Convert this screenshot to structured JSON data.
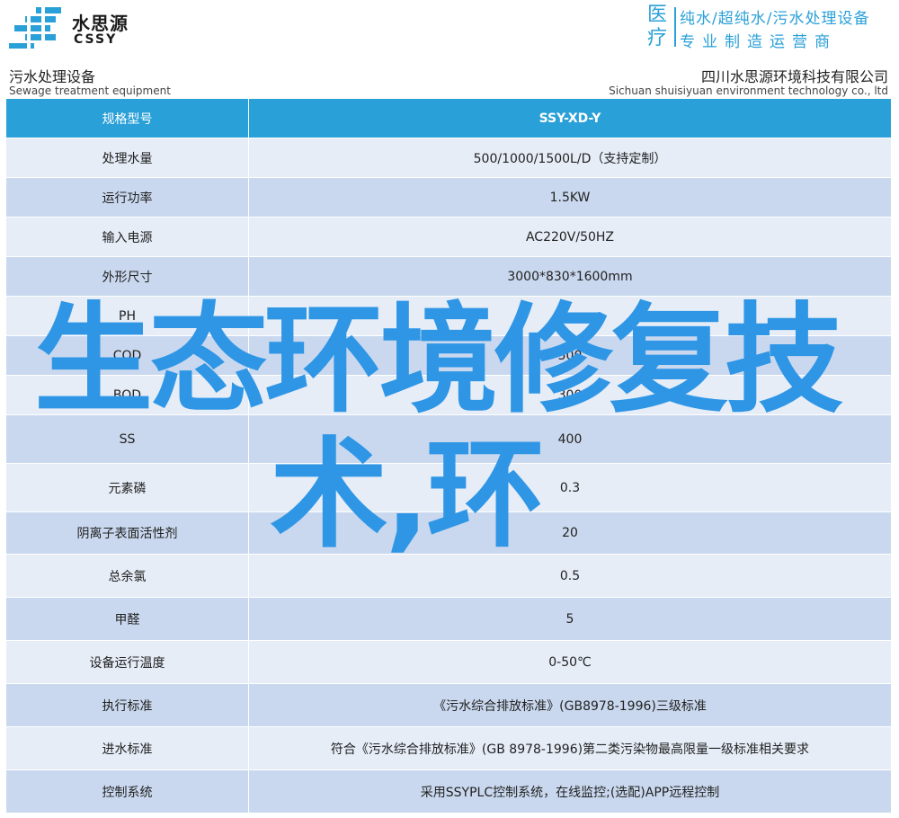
{
  "brand": {
    "name_cn": "水思源",
    "name_en": "CSSY",
    "accent_color": "#2aa0d8"
  },
  "header_right": {
    "category": "医疗",
    "line1": "纯水/超纯水/污水处理设备",
    "line2": "专业制造运营商"
  },
  "subheader": {
    "left_cn": "污水处理设备",
    "left_en": "Sewage treatment equipment",
    "right_cn": "四川水思源环境科技有限公司",
    "right_en": "Sichuan shuisiyuan environment technology co., ltd"
  },
  "table": {
    "header": {
      "label": "规格型号",
      "value": "SSY-XD-Y"
    },
    "rows": [
      {
        "label": "处理水量",
        "value": "500/1000/1500L/D（支持定制）"
      },
      {
        "label": "运行功率",
        "value": "1.5KW"
      },
      {
        "label": "输入电源",
        "value": "AC220V/50HZ"
      },
      {
        "label": "外形尺寸",
        "value": "3000*830*1600mm"
      },
      {
        "label": "PH",
        "value": "6~"
      },
      {
        "label": "COD",
        "value": "500"
      },
      {
        "label": "BOD",
        "value": "300"
      },
      {
        "label": "SS",
        "value": "400"
      },
      {
        "label": "元素磷",
        "value": "0.3"
      },
      {
        "label": "阴离子表面活性剂",
        "value": "20"
      },
      {
        "label": "总余氯",
        "value": "0.5"
      },
      {
        "label": "甲醛",
        "value": "5"
      },
      {
        "label": "设备运行温度",
        "value": "0-50℃"
      },
      {
        "label": "执行标准",
        "value": "《污水综合排放标准》(GB8978-1996)三级标准"
      },
      {
        "label": "进水标准",
        "value": "符合《污水综合排放标准》(GB 8978-1996)第二类污染物最高限量一级标准相关要求"
      },
      {
        "label": "控制系统",
        "value": "采用SSYPLC控制系统，在线监控;(选配)APP远程控制"
      }
    ]
  },
  "overlay": {
    "line1": "生态环境修复技",
    "line2": "术,环",
    "color": "#2f96e6"
  }
}
